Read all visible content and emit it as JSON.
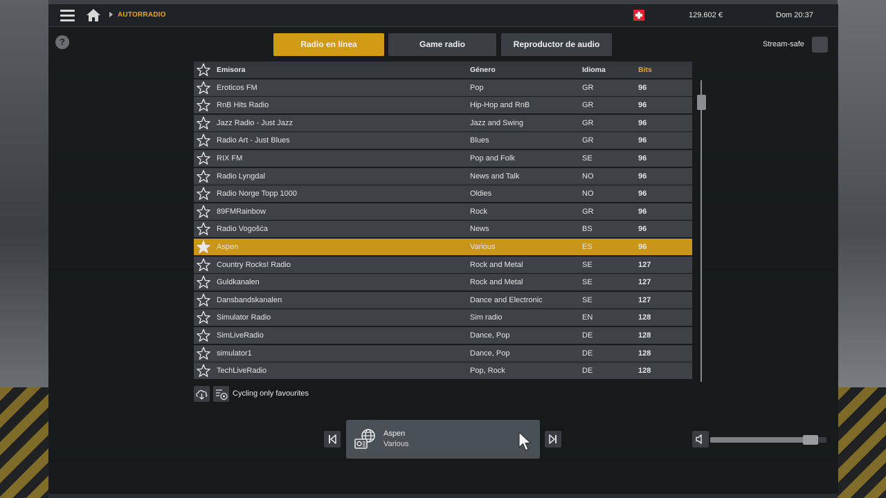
{
  "topbar": {
    "breadcrumb": "AUTORRADIO",
    "money": "129.602 €",
    "clock": "Dom 20:37"
  },
  "help": {
    "label": "?"
  },
  "tabs": [
    {
      "label": "Radio en línea",
      "active": true
    },
    {
      "label": "Game radio",
      "active": false
    },
    {
      "label": "Reproductor de audio",
      "active": false
    }
  ],
  "stream_safe": {
    "label": "Stream-safe",
    "checked": false
  },
  "table": {
    "headers": {
      "station": "Emisora",
      "genre": "Género",
      "language": "Idioma",
      "bits": "Bits"
    },
    "rows": [
      {
        "name": "Eroticos FM",
        "genre": "Pop",
        "lang": "GR",
        "bits": "96",
        "selected": false
      },
      {
        "name": "RnB Hits Radio",
        "genre": "Hip-Hop and RnB",
        "lang": "GR",
        "bits": "96",
        "selected": false
      },
      {
        "name": "Jazz Radio - Just Jazz",
        "genre": "Jazz and Swing",
        "lang": "GR",
        "bits": "96",
        "selected": false
      },
      {
        "name": "Radio Art - Just Blues",
        "genre": "Blues",
        "lang": "GR",
        "bits": "96",
        "selected": false
      },
      {
        "name": "RIX FM",
        "genre": "Pop and Folk",
        "lang": "SE",
        "bits": "96",
        "selected": false
      },
      {
        "name": "Radio Lyngdal",
        "genre": "News and Talk",
        "lang": "NO",
        "bits": "96",
        "selected": false
      },
      {
        "name": "Radio Norge Topp 1000",
        "genre": "Oldies",
        "lang": "NO",
        "bits": "96",
        "selected": false
      },
      {
        "name": "89FMRainbow",
        "genre": "Rock",
        "lang": "GR",
        "bits": "96",
        "selected": false
      },
      {
        "name": "Radio Vogošća",
        "genre": "News",
        "lang": "BS",
        "bits": "96",
        "selected": false
      },
      {
        "name": "Aspen",
        "genre": "Various",
        "lang": "ES",
        "bits": "96",
        "selected": true
      },
      {
        "name": "Country Rocks! Radio",
        "genre": "Rock and Metal",
        "lang": "SE",
        "bits": "127",
        "selected": false
      },
      {
        "name": "Guldkanalen",
        "genre": "Rock and Metal",
        "lang": "SE",
        "bits": "127",
        "selected": false
      },
      {
        "name": "Dansbandskanalen",
        "genre": "Dance and Electronic",
        "lang": "SE",
        "bits": "127",
        "selected": false
      },
      {
        "name": "Simulator Radio",
        "genre": "Sim radio",
        "lang": "EN",
        "bits": "128",
        "selected": false
      },
      {
        "name": "SimLiveRadio",
        "genre": "Dance, Pop",
        "lang": "DE",
        "bits": "128",
        "selected": false
      },
      {
        "name": "simulator1",
        "genre": "Dance, Pop",
        "lang": "DE",
        "bits": "128",
        "selected": false
      },
      {
        "name": "TechLiveRadio",
        "genre": "Pop, Rock",
        "lang": "DE",
        "bits": "128",
        "selected": false
      }
    ]
  },
  "cycle": {
    "label": "Cycling only favourites"
  },
  "now_playing": {
    "title": "Aspen",
    "genre": "Various"
  },
  "volume": {
    "level": 0.92
  },
  "colors": {
    "accent": "#d09a14",
    "selected_row": "#c8941a",
    "row": "#3e4246",
    "flag": "#e0262b"
  },
  "icons": {
    "menu": "hamburger-icon",
    "home": "home-icon",
    "flag": "swiss-flag-icon",
    "favourite": "star-icon",
    "prev": "skip-previous-icon",
    "next": "skip-next-icon",
    "volume": "speaker-icon",
    "radio": "internet-radio-icon"
  }
}
